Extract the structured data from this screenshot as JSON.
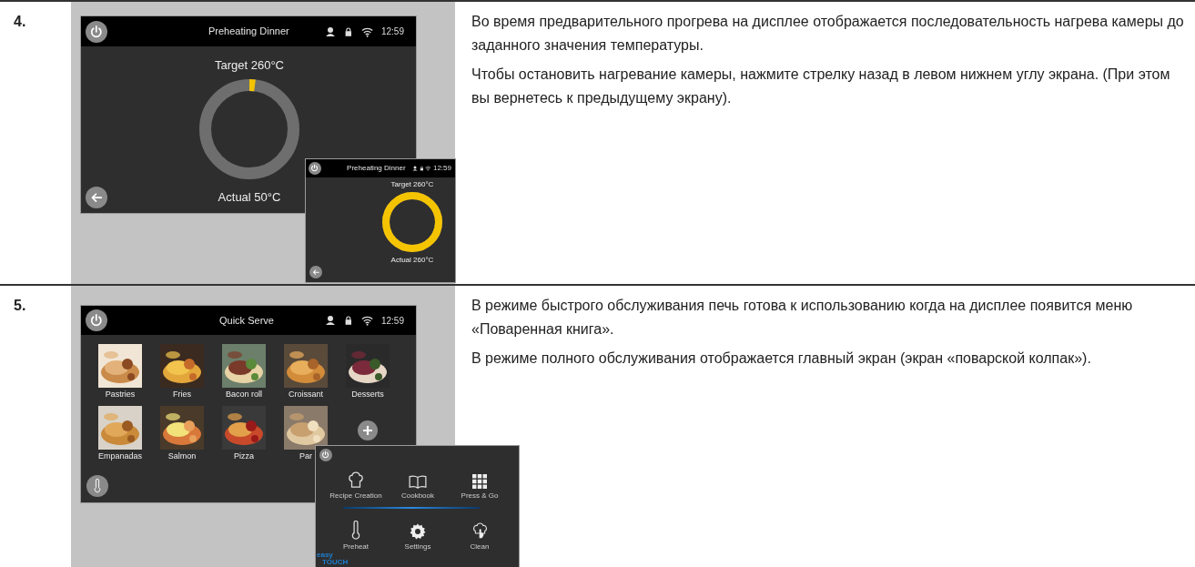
{
  "rows": [
    {
      "number": "4.",
      "screens": [
        {
          "kind": "preheat",
          "title": "Preheating Dinner",
          "time": "12:59",
          "target": "Target 260°C",
          "actual": "Actual 50°C",
          "level": 0.02
        },
        {
          "kind": "preheat",
          "title": "Preheating Dinner",
          "time": "12:59",
          "target": "Target 260°C",
          "actual": "Actual 260°C",
          "level": 1
        }
      ],
      "paragraphs": [
        "Во время предварительного прогрева на дисплее отображается последовательность нагрева камеры до заданного значения температуры.",
        "Чтобы остановить нагревание камеры, нажмите стрелку назад в левом нижнем углу экрана. (При этом вы вернетесь к предыдущему экрану)."
      ]
    },
    {
      "number": "5.",
      "screens": [
        {
          "kind": "quick_serve",
          "title": "Quick Serve",
          "time": "12:59",
          "tiles": [
            "Pastries",
            "Fries",
            "Bacon roll",
            "Croissant",
            "Desserts",
            "Empanadas",
            "Salmon",
            "Pizza",
            "Par"
          ]
        },
        {
          "kind": "menu",
          "items": [
            {
              "label": "Recipe Creation",
              "kind": "chef-hat"
            },
            {
              "label": "Cookbook",
              "kind": "book"
            },
            {
              "label": "Press & Go",
              "kind": "grid"
            },
            {
              "label": "Preheat",
              "kind": "thermometer"
            },
            {
              "label": "Settings",
              "kind": "gear"
            },
            {
              "label": "Clean",
              "kind": "hand"
            }
          ],
          "logo": [
            "easy",
            "TOUCH"
          ]
        }
      ],
      "paragraphs": [
        "В режиме быстрого обслуживания печь готова к использованию когда на дисплее появится меню «Поваренная книга».",
        "В режиме полного обслуживания отображается главный экран (экран «поварской колпак»)."
      ]
    }
  ]
}
